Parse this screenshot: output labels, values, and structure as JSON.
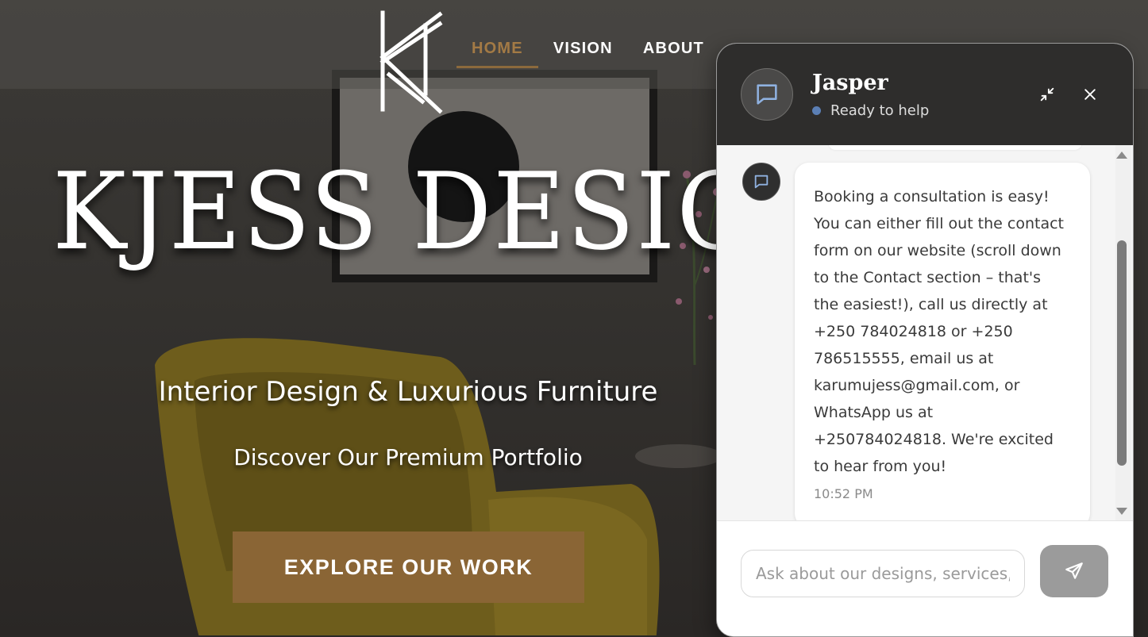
{
  "site": {
    "logo_alt": "KJ monogram logo",
    "nav": {
      "items": [
        {
          "label": "HOME",
          "active": true
        },
        {
          "label": "VISION",
          "active": false
        },
        {
          "label": "ABOUT",
          "active": false
        }
      ]
    },
    "hero": {
      "brand": "KJESS DESIGN",
      "tagline": "Interior Design & Luxurious Furniture",
      "subtagline": "Discover Our Premium Portfolio",
      "cta_label": "EXPLORE OUR WORK"
    },
    "colors": {
      "accent": "#8a6535",
      "nav_active": "#a37a45",
      "chat_header": "#2e2d2c",
      "status_dot": "#5b7fb5"
    }
  },
  "chat": {
    "assistant_name": "Jasper",
    "status": "Ready to help",
    "header_icons": [
      "chat-bubble-icon",
      "minimize-icon",
      "close-icon"
    ],
    "messages": [
      {
        "from": "bot",
        "text": "Booking a consultation is easy!\nYou can either fill out the contact\nform on our website (scroll down\nto the Contact section – that's\nthe easiest!), call us directly at\n+250 784024818 or +250\n786515555, email us at\nkarumujess@gmail.com, or\nWhatsApp us at\n+250784024818. We're excited\nto hear from you!",
        "time": "10:52 PM"
      }
    ],
    "input": {
      "placeholder": "Ask about our designs, services, or booking...",
      "value": ""
    },
    "send_icon": "send-icon"
  }
}
